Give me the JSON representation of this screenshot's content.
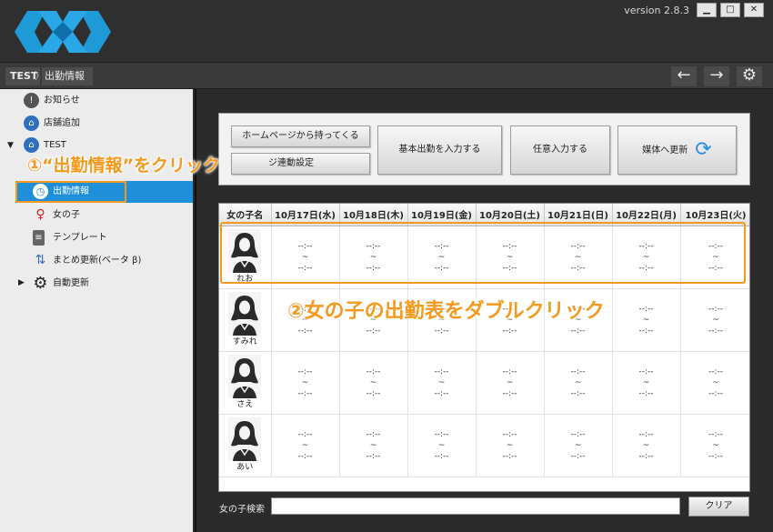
{
  "window": {
    "version": "version 2.8.3",
    "minimize_glyph": "▁",
    "maximize_glyph": "□",
    "close_glyph": "✕"
  },
  "breadcrumb": {
    "root": "TEST",
    "separator": "〉",
    "current": "出勤情報"
  },
  "nav": {
    "back_glyph": "←",
    "forward_glyph": "→",
    "settings_glyph": "⚙"
  },
  "sidebar": {
    "items": [
      {
        "label": "お知らせ",
        "icon": "notice-icon"
      },
      {
        "label": "店舗追加",
        "icon": "add-store-icon"
      },
      {
        "label": "TEST",
        "icon": "store-home-icon"
      },
      {
        "label": "アカ",
        "icon": "account-icon"
      },
      {
        "label": "出勤情報",
        "icon": "clock-icon"
      },
      {
        "label": "女の子",
        "icon": "girl-icon"
      },
      {
        "label": "テンプレート",
        "icon": "template-icon"
      },
      {
        "label": "まとめ更新(ベータ β)",
        "icon": "bulk-update-icon"
      },
      {
        "label": "自動更新",
        "icon": "gear-icon"
      }
    ]
  },
  "toolbar": {
    "fetch_homepage": "ホームページから持ってくる",
    "link_settings": "ジ連動設定",
    "basic_shift": "基本出勤を入力する",
    "manual_input": "任意入力する",
    "update_media": "媒体へ更新"
  },
  "grid": {
    "headers": [
      "女の子名",
      "10月17日(水)",
      "10月18日(木)",
      "10月19日(金)",
      "10月20日(土)",
      "10月21日(日)",
      "10月22日(月)",
      "10月23日(火)"
    ],
    "empty_time": "--:--",
    "tilde": "~",
    "girls": [
      "れお",
      "すみれ",
      "さえ",
      "あい"
    ]
  },
  "search": {
    "label": "女の子検索",
    "value": "",
    "clear_label": "クリア"
  },
  "annotations": {
    "step1": "①“出勤情報”をクリック",
    "step2": "②女の子の出勤表をダブルクリック"
  },
  "colors": {
    "accent": "#1e8fd8",
    "highlight": "#f39a1e",
    "logo": "#1e9ad6"
  }
}
